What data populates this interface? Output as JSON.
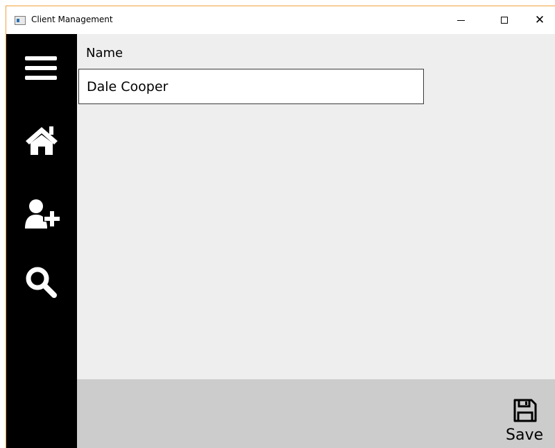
{
  "window": {
    "title": "Client Management"
  },
  "sidebar": {
    "items": [
      {
        "icon": "hamburger-menu-icon"
      },
      {
        "icon": "home-icon"
      },
      {
        "icon": "add-user-icon"
      },
      {
        "icon": "search-icon"
      }
    ]
  },
  "form": {
    "name_label": "Name",
    "name_value": "Dale Cooper"
  },
  "footer": {
    "save_label": "Save",
    "save_icon": "floppy-disk-icon"
  },
  "colors": {
    "sidebar_bg": "#000000",
    "content_bg": "#eeeeee",
    "footer_bg": "#cccccc"
  }
}
